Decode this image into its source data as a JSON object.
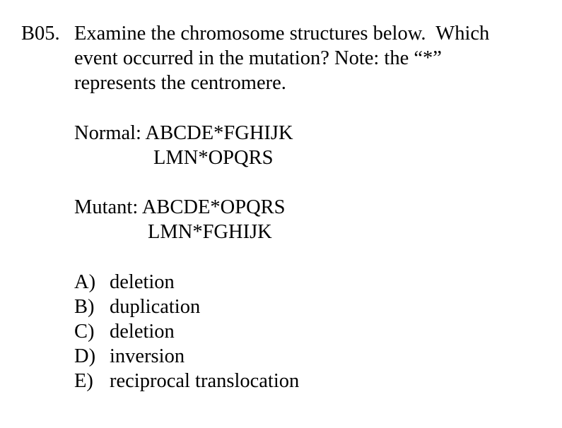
{
  "question": {
    "number": "B05.",
    "text_lines": [
      "Examine the chromosome structures below.  Which",
      "event occurred in the mutation? Note: the “*”",
      "represents the centromere."
    ]
  },
  "normal": {
    "label": "Normal:",
    "line1": "ABCDE*FGHIJK",
    "line2": "LMN*OPQRS"
  },
  "mutant": {
    "label": "Mutant:",
    "line1": "ABCDE*OPQRS",
    "line2": "LMN*FGHIJK"
  },
  "options": [
    {
      "letter": "A)",
      "text": "deletion"
    },
    {
      "letter": "B)",
      "text": "duplication"
    },
    {
      "letter": "C)",
      "text": "deletion"
    },
    {
      "letter": "D)",
      "text": "inversion"
    },
    {
      "letter": "E)",
      "text": "reciprocal translocation"
    }
  ]
}
